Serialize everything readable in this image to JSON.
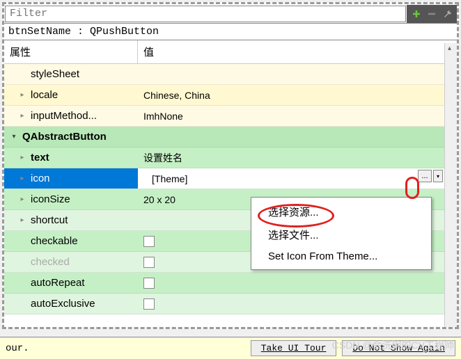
{
  "filter": {
    "placeholder": "Filter"
  },
  "object_label": "btnSetName : QPushButton",
  "headers": {
    "property": "属性",
    "value": "值"
  },
  "rows": [
    {
      "type": "prop",
      "name": "styleSheet",
      "value": "",
      "color": "yellow-alt",
      "expand": "none"
    },
    {
      "type": "prop",
      "name": "locale",
      "value": "Chinese, China",
      "color": "yellow",
      "expand": "right"
    },
    {
      "type": "prop",
      "name": "inputMethod...",
      "value": "ImhNone",
      "color": "yellow-alt",
      "expand": "right"
    },
    {
      "type": "group",
      "name": "QAbstractButton",
      "color": "group",
      "expand": "down"
    },
    {
      "type": "prop",
      "name": "text",
      "value": "设置姓名",
      "color": "green",
      "expand": "right",
      "bold": true
    },
    {
      "type": "prop",
      "name": "icon",
      "value": "[Theme]",
      "color": "green-alt",
      "expand": "right",
      "selected": true,
      "editing": true
    },
    {
      "type": "prop",
      "name": "iconSize",
      "value": "20 x 20",
      "color": "green",
      "expand": "right"
    },
    {
      "type": "prop",
      "name": "shortcut",
      "value": "",
      "color": "green-alt",
      "expand": "right"
    },
    {
      "type": "prop",
      "name": "checkable",
      "value": "",
      "color": "green",
      "expand": "none",
      "checkbox": true
    },
    {
      "type": "prop",
      "name": "checked",
      "value": "",
      "color": "green-alt",
      "expand": "none",
      "checkbox": true,
      "disabled": true
    },
    {
      "type": "prop",
      "name": "autoRepeat",
      "value": "",
      "color": "green",
      "expand": "none",
      "checkbox": true
    },
    {
      "type": "prop",
      "name": "autoExclusive",
      "value": "",
      "color": "green-alt",
      "expand": "none",
      "checkbox": true
    }
  ],
  "context_menu": {
    "items": [
      "选择资源...",
      "选择文件...",
      "Set Icon From Theme..."
    ]
  },
  "bottom": {
    "left_text": "our.",
    "tour_btn": "Take UI Tour",
    "dismiss_btn": "Do Not Show Again"
  },
  "watermark": "CSDN @会洗碗的CV工程师"
}
